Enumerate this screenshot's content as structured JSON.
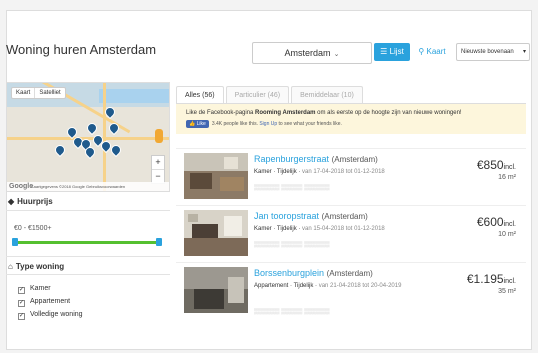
{
  "page": {
    "title": "Woning huren Amsterdam"
  },
  "toolbar": {
    "city": "Amsterdam",
    "list_label": "Lijst",
    "map_label": "Kaart",
    "sort_value": "Nieuwste bovenaan"
  },
  "map": {
    "tab_map": "Kaart",
    "tab_satellite": "Satelliet",
    "footer": "Kaartgegevens ©2018 Google   Gebruiksvoorwaarden",
    "logo": "Google"
  },
  "sidebar": {
    "price_heading": "Huurprijs",
    "price_range": "€0 - €1500+",
    "type_heading": "Type woning",
    "types": [
      {
        "label": "Kamer",
        "checked": true
      },
      {
        "label": "Appartement",
        "checked": true
      },
      {
        "label": "Volledige woning",
        "checked": true
      }
    ]
  },
  "tabs": [
    {
      "label": "Alles (56)",
      "active": true
    },
    {
      "label": "Particulier (46)",
      "active": false
    },
    {
      "label": "Bemiddelaar (10)",
      "active": false
    }
  ],
  "banner": {
    "text_pre": "Like de Facebook-pagina ",
    "text_brand": "Rooming Amsterdam",
    "text_post": " om als eerste op de hoogte zijn van nieuwe woningen!",
    "like_button": "Like",
    "like_count_text": "3.4K people like this.",
    "signup_link": "Sign Up",
    "signup_post": " to see what your friends like."
  },
  "listings": [
    {
      "street": "Rapenburgerstraat",
      "city": "(Amsterdam)",
      "type": "Kamer",
      "term": "Tijdelijk",
      "period": "van 17-04-2018 tot 01-12-2018",
      "price": "€850",
      "incl": "incl.",
      "area": "16 m²"
    },
    {
      "street": "Jan tooropstraat",
      "city": "(Amsterdam)",
      "type": "Kamer",
      "term": "Tijdelijk",
      "period": "van 15-04-2018 tot 01-12-2018",
      "price": "€600",
      "incl": "incl.",
      "area": "10 m²"
    },
    {
      "street": "Borssenburgplein",
      "city": "(Amsterdam)",
      "type": "Appartement",
      "term": "Tijdelijk",
      "period": "van 21-04-2018 tot 20-04-2019",
      "price": "€1.195",
      "incl": "incl.",
      "area": "35 m²"
    }
  ],
  "colors": {
    "accent": "#2aa2dd",
    "slider": "#55c030",
    "banner_bg": "#fdf6dc",
    "pin": "#1f5a8c"
  }
}
